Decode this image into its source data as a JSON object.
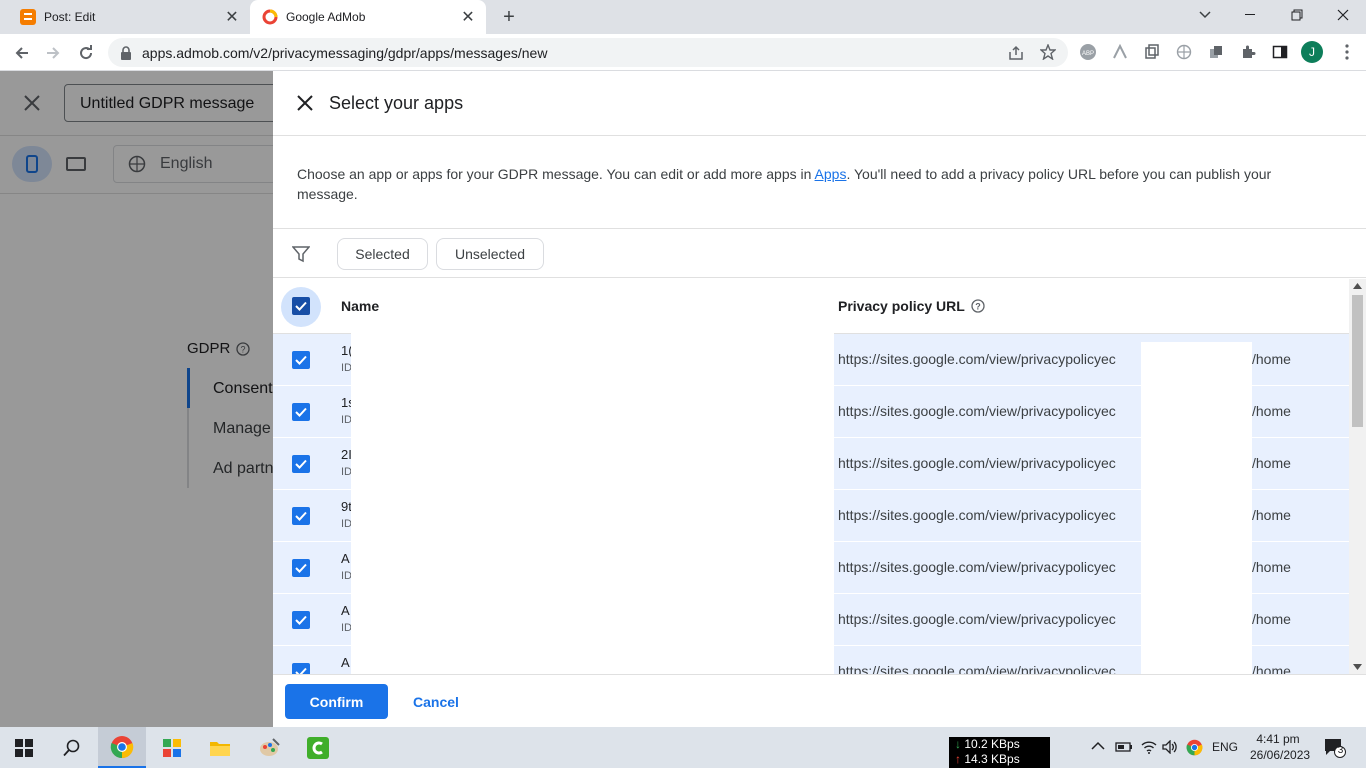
{
  "browser": {
    "tabs": [
      {
        "title": "Post: Edit",
        "favicon": "blogger-icon"
      },
      {
        "title": "Google AdMob",
        "favicon": "admob-icon",
        "active": true
      }
    ],
    "url": "apps.admob.com/v2/privacymessaging/gdpr/apps/messages/new",
    "profile_initial": "J"
  },
  "background_page": {
    "title_input_value": "Untitled GDPR message",
    "language": "English",
    "section_label": "GDPR",
    "nav_items": [
      "Consent",
      "Manage",
      "Ad partn"
    ]
  },
  "panel": {
    "title": "Select your apps",
    "description_before": "Choose an app or apps for your GDPR message. You can edit or add more apps in ",
    "description_link": "Apps",
    "description_after": ". You'll need to add a privacy policy URL before you can publish your message.",
    "filters": {
      "selected": "Selected",
      "unselected": "Unselected"
    },
    "columns": {
      "name": "Name",
      "privacy": "Privacy policy URL"
    },
    "rows": [
      {
        "name": "1(",
        "id": "ID",
        "url_prefix": "https://sites.google.com/view/privacypolicyec",
        "url_suffix": "/home"
      },
      {
        "name": "1s",
        "id": "ID",
        "url_prefix": "https://sites.google.com/view/privacypolicyec",
        "url_suffix": "/home"
      },
      {
        "name": "2I",
        "id": "ID",
        "url_prefix": "https://sites.google.com/view/privacypolicyec",
        "url_suffix": "/home"
      },
      {
        "name": "9t",
        "id": "ID",
        "url_prefix": "https://sites.google.com/view/privacypolicyec",
        "url_suffix": "/home"
      },
      {
        "name": "A",
        "id": "ID",
        "url_prefix": "https://sites.google.com/view/privacypolicyec",
        "url_suffix": "/home"
      },
      {
        "name": "A",
        "id": "ID",
        "url_prefix": "https://sites.google.com/view/privacypolicyec",
        "url_suffix": "/home"
      },
      {
        "name": "A",
        "id": "",
        "url_prefix": "https://sites.google.com/view/privacypolicyec",
        "url_suffix": "/home"
      }
    ],
    "confirm": "Confirm",
    "cancel": "Cancel"
  },
  "taskbar": {
    "down_speed": "10.2 KBps",
    "up_speed": "14.3 KBps",
    "language": "ENG",
    "time": "4:41 pm",
    "date": "26/06/2023",
    "notifications": "3"
  },
  "colors": {
    "accent": "#1a73e8",
    "row_selected": "#e8f0fe"
  }
}
